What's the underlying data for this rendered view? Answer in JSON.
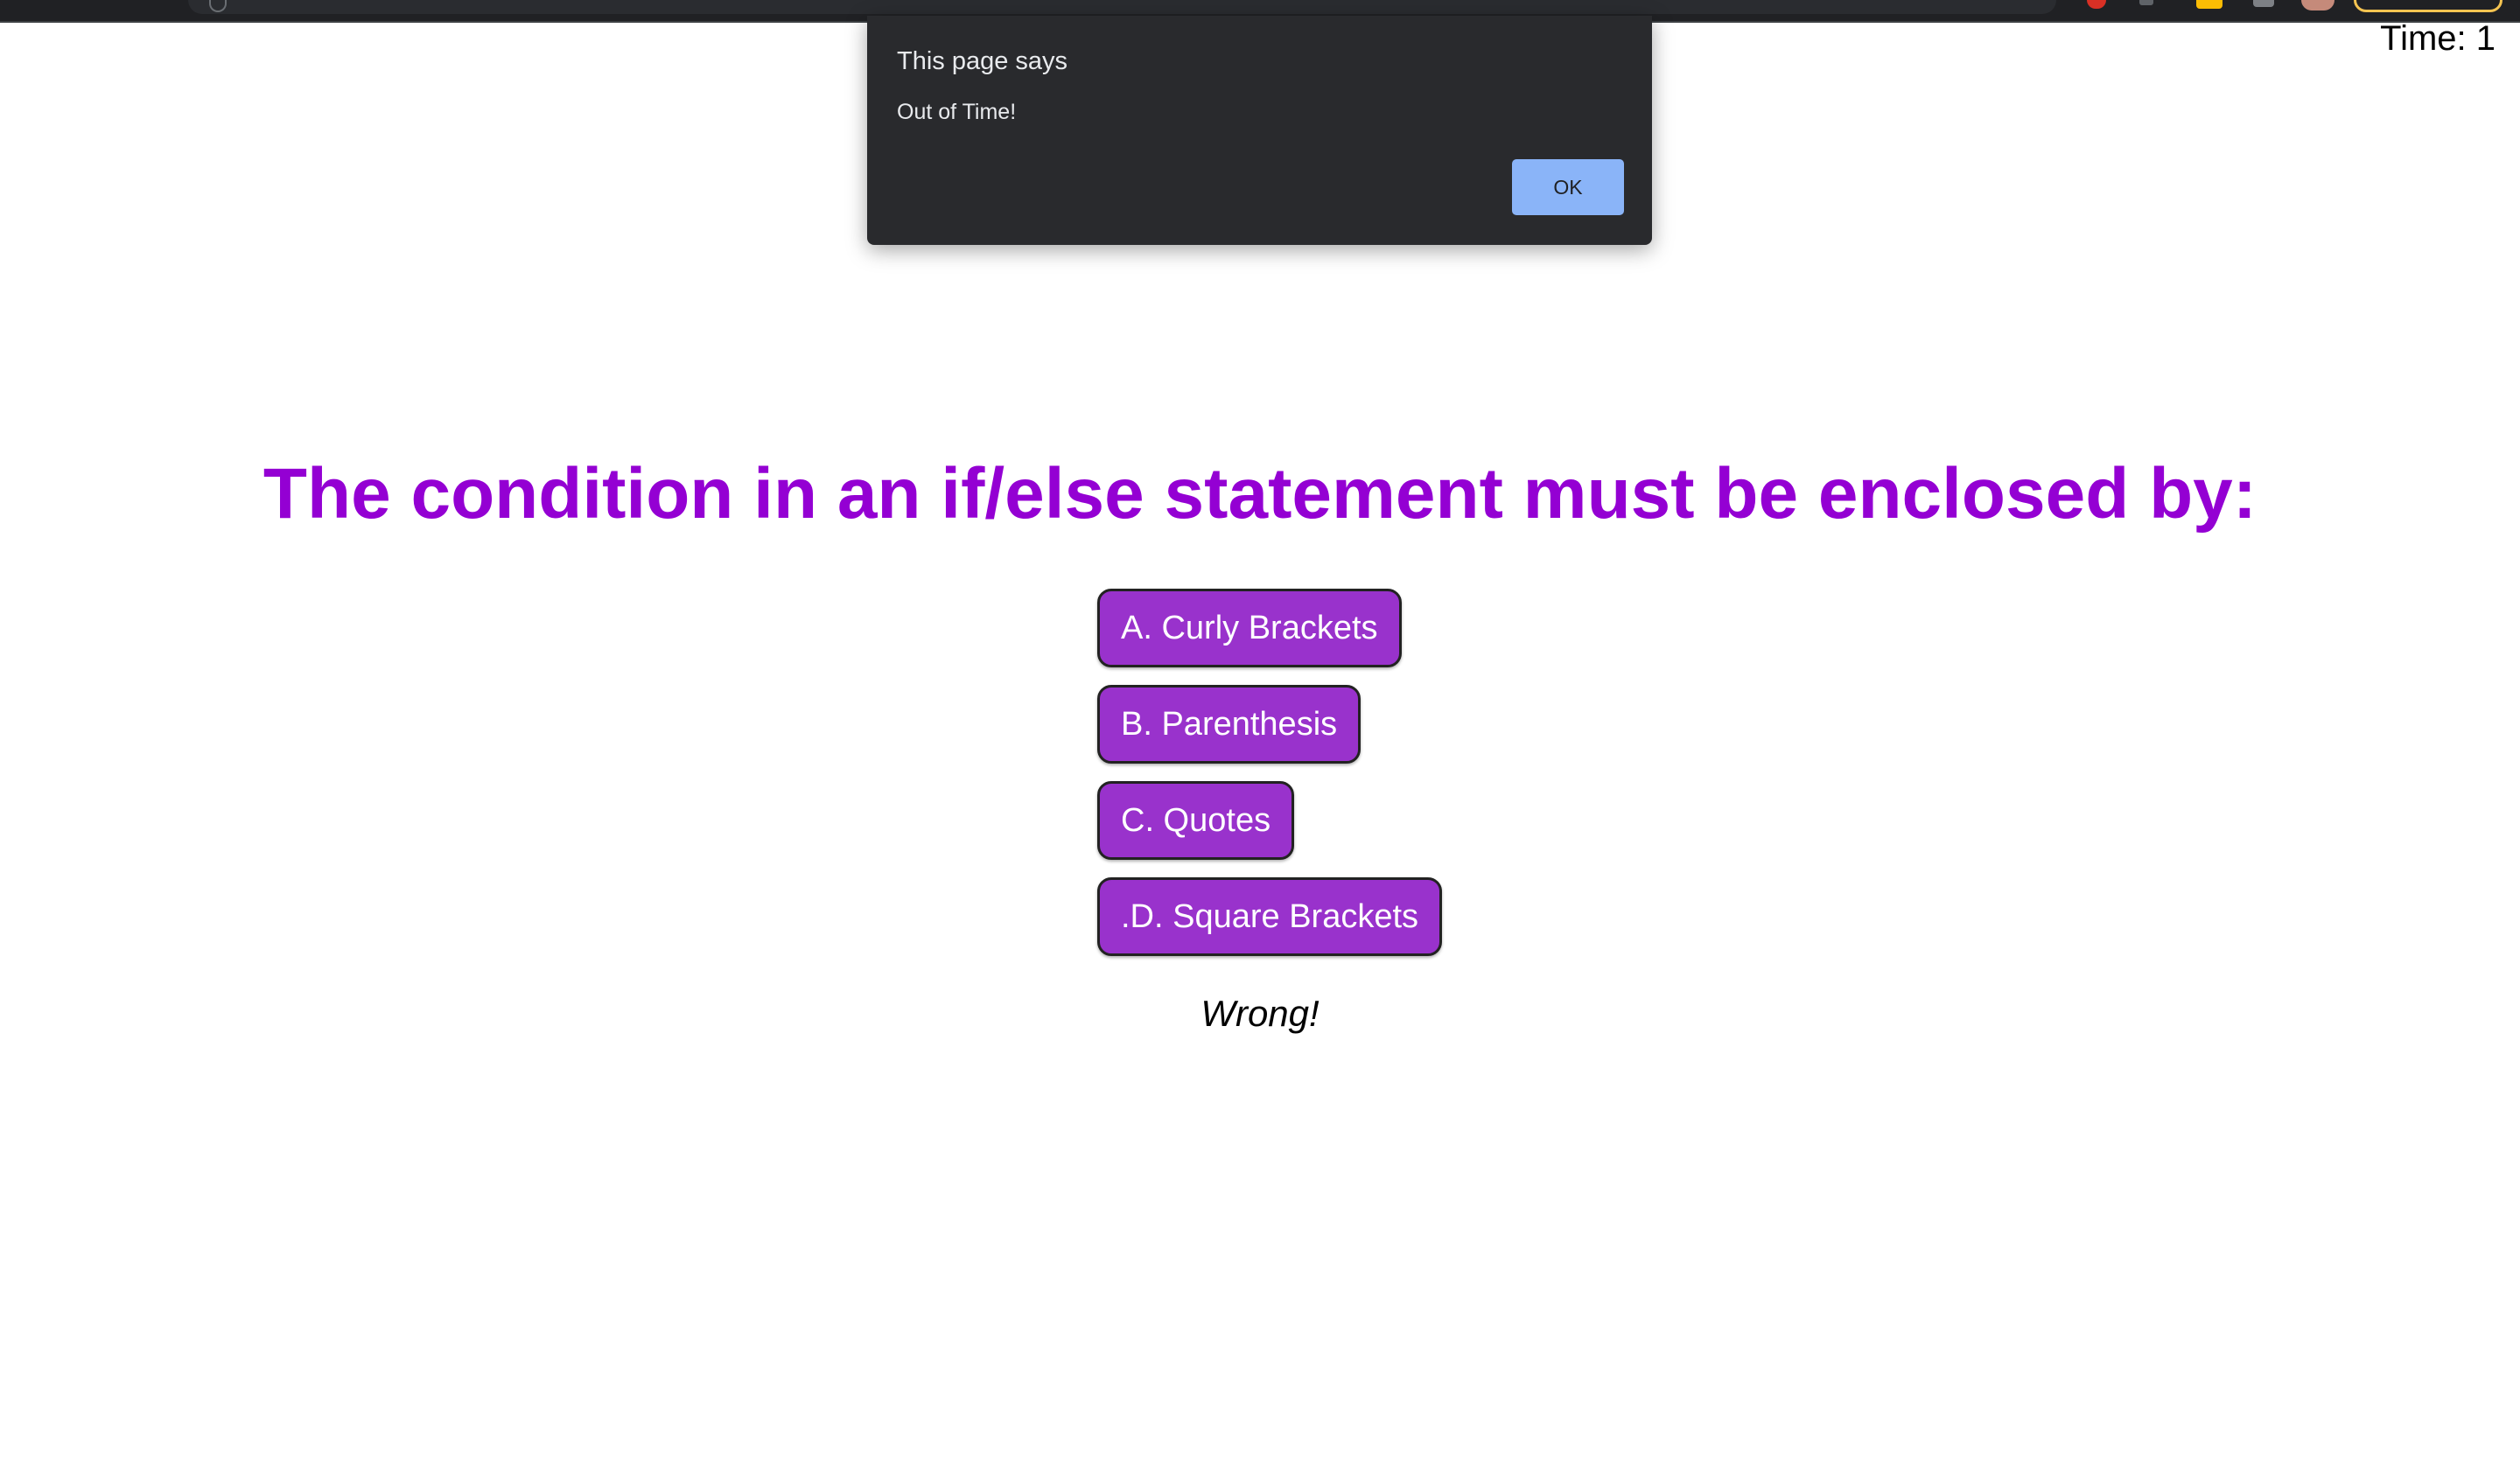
{
  "timer": {
    "text": "Time: 1"
  },
  "dialog": {
    "title": "This page says",
    "message": "Out of Time!",
    "ok_label": "OK"
  },
  "quiz": {
    "question": "The condition in an if/else statement must be enclosed by:",
    "answers": [
      {
        "label": "A. Curly Brackets"
      },
      {
        "label": "B. Parenthesis"
      },
      {
        "label": "C. Quotes"
      },
      {
        "label": ".D. Square Brackets"
      }
    ],
    "feedback": "Wrong!"
  },
  "colors": {
    "question_text": "#9400d3",
    "answer_bg": "#9932cc",
    "ok_button": "#8ab4f8",
    "dialog_bg": "#292a2d"
  },
  "icons": [
    "lock-icon",
    "extension-icon",
    "puzzle-icon",
    "profile-avatar"
  ]
}
